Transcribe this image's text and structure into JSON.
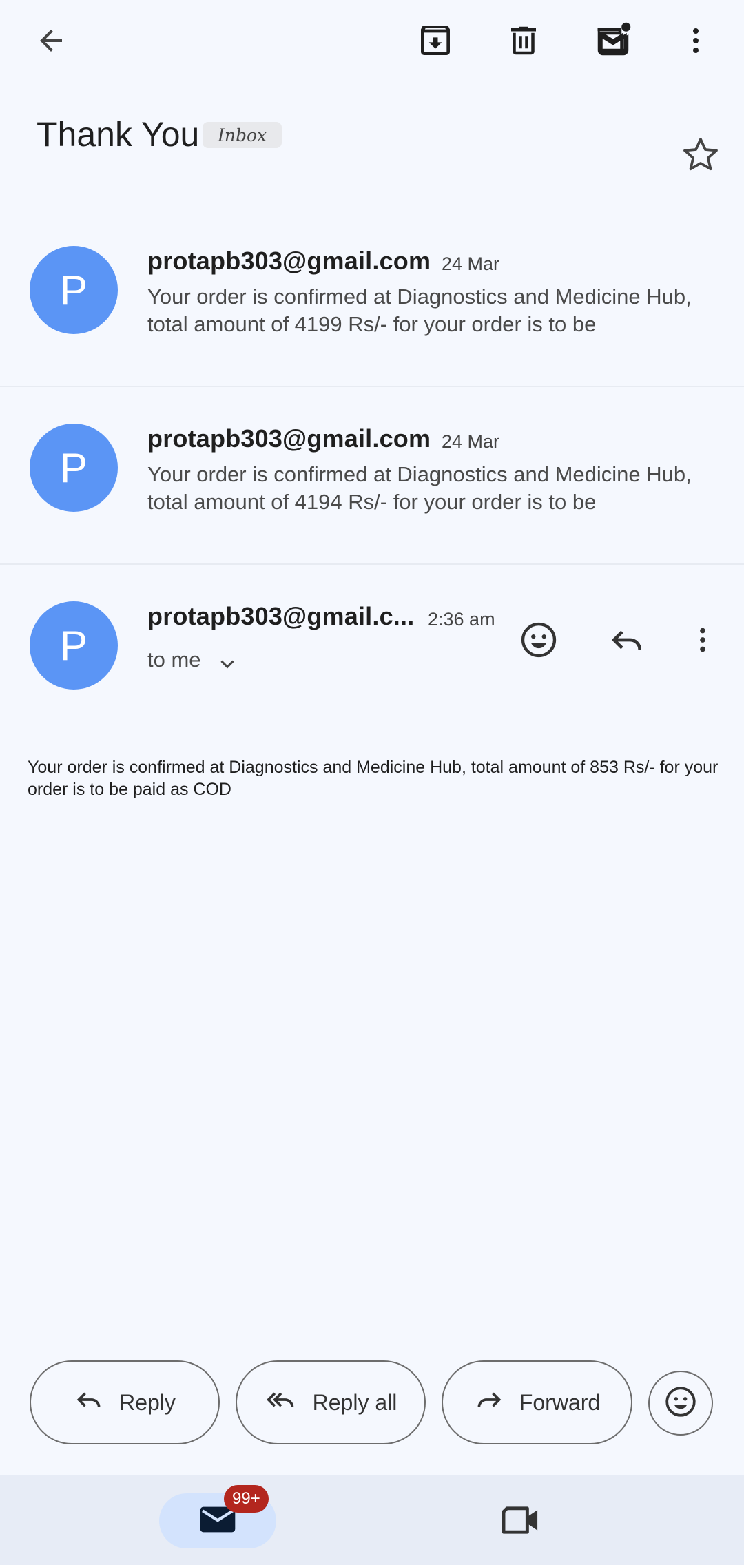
{
  "header": {
    "back_icon": "arrow-left-icon",
    "actions": [
      "archive-icon",
      "delete-icon",
      "mark-unread-icon",
      "more-vert-icon"
    ]
  },
  "subject": {
    "title": "Thank You",
    "label": "Inbox",
    "star_icon": "star-outline-icon"
  },
  "messages": [
    {
      "avatar": "P",
      "sender": "protapb303@gmail.com",
      "date": "24 Mar",
      "snippet": "Your order is confirmed at Diagnostics and Medicine Hub, total amount of 4199 Rs/- for your order is to be"
    },
    {
      "avatar": "P",
      "sender": "protapb303@gmail.com",
      "date": "24 Mar",
      "snippet": "Your order is confirmed at Diagnostics and Medicine Hub, total amount of 4194 Rs/- for your order is to be"
    }
  ],
  "open_message": {
    "avatar": "P",
    "sender": "protapb303@gmail.c...",
    "time": "2:36 am",
    "recipient": "to me",
    "body": "Your order is confirmed at Diagnostics and Medicine Hub, total amount of 853 Rs/- for your order is to be paid as COD"
  },
  "actions": {
    "reply": "Reply",
    "reply_all": "Reply all",
    "forward": "Forward"
  },
  "bottom_nav": {
    "mail_badge": "99+",
    "mail_icon": "mail-icon",
    "meet_icon": "video-camera-icon"
  },
  "colors": {
    "avatar": "#5b95f5",
    "background": "#f5f8fe",
    "badge": "#b3261e",
    "nav_active": "#d3e3fd"
  }
}
